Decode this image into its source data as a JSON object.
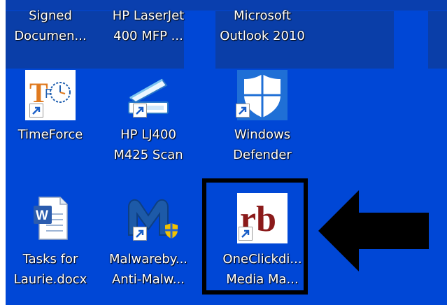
{
  "desktop": {
    "colors": {
      "background": "#0047d6",
      "label": "#ffffff",
      "highlight": "#000000"
    },
    "icons": [
      {
        "id": "signed-documents",
        "label": "Signed\nDocumen...",
        "icon": "folder-icon"
      },
      {
        "id": "hp-laserjet",
        "label": "HP LaserJet\n400 MFP ...",
        "icon": "printer-icon"
      },
      {
        "id": "outlook-2010",
        "label": "Microsoft\nOutlook 2010",
        "icon": "outlook-icon"
      },
      {
        "id": "timeforce",
        "label": "TimeForce",
        "icon": "timeforce-icon"
      },
      {
        "id": "hp-lj400-scan",
        "label": "HP LJ400\nM425 Scan",
        "icon": "scanner-icon"
      },
      {
        "id": "windows-defender",
        "label": "Windows\nDefender",
        "icon": "shield-icon"
      },
      {
        "id": "tasks-for-laurie",
        "label": "Tasks for\nLaurie.docx",
        "icon": "word-document-icon"
      },
      {
        "id": "malwarebytes",
        "label": "Malwareby...\nAnti-Malw...",
        "icon": "malwarebytes-icon"
      },
      {
        "id": "oneclickdigital",
        "label": "OneClickdi...\nMedia Ma...",
        "icon": "rb-logo-icon"
      }
    ],
    "annotation": {
      "target": "oneclickdigital",
      "pointer": "arrow-left-icon"
    }
  }
}
